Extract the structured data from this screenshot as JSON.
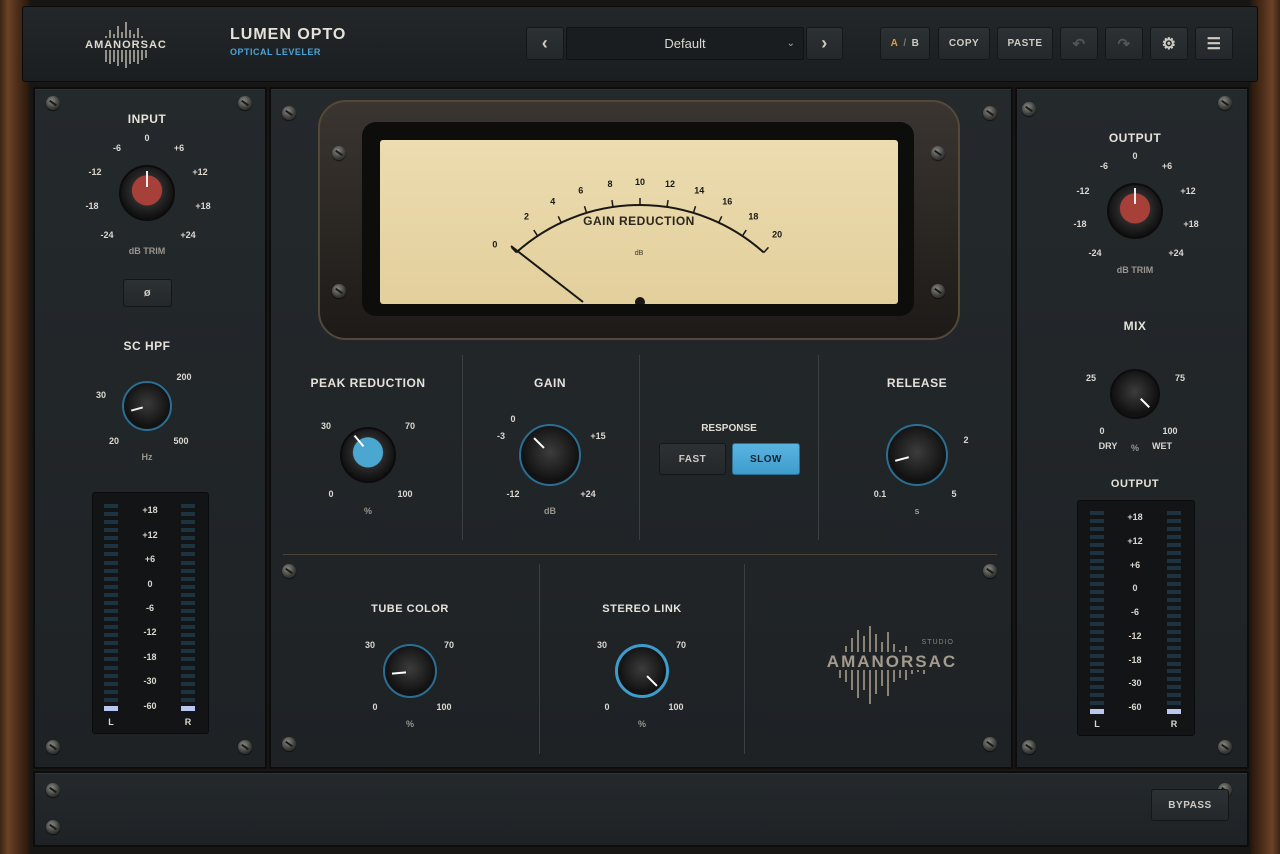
{
  "header": {
    "brand": "AMANORSAC",
    "plugin_name": "LUMEN OPTO",
    "plugin_subtitle": "OPTICAL LEVELER",
    "preset": "Default",
    "ab_a": "A",
    "ab_sep": "/",
    "ab_b": "B",
    "copy": "COPY",
    "paste": "PASTE"
  },
  "input": {
    "title": "INPUT",
    "unit": "dB TRIM",
    "ticks": [
      "-24",
      "-18",
      "-12",
      "-6",
      "0",
      "+6",
      "+12",
      "+18",
      "+24"
    ],
    "value_db": 0,
    "phase_label": "ø"
  },
  "sc_hpf": {
    "title": "SC HPF",
    "unit": "Hz",
    "ticks": [
      "20",
      "30",
      "200",
      "500"
    ]
  },
  "left_meter": {
    "scale": [
      "+18",
      "+12",
      "+6",
      "0",
      "-6",
      "-12",
      "-18",
      "-30",
      "-60"
    ],
    "l": "L",
    "r": "R"
  },
  "vu": {
    "title": "GAIN REDUCTION",
    "unit": "dB",
    "scale": [
      "0",
      "2",
      "4",
      "6",
      "8",
      "10",
      "12",
      "14",
      "16",
      "18",
      "20"
    ],
    "value_db": 0
  },
  "peak_reduction": {
    "title": "PEAK REDUCTION",
    "unit": "%",
    "ticks": [
      "0",
      "30",
      "70",
      "100"
    ]
  },
  "gain": {
    "title": "GAIN",
    "unit": "dB",
    "ticks": [
      "-12",
      "-3",
      "0",
      "+15",
      "+24"
    ]
  },
  "response": {
    "title": "RESPONSE",
    "fast": "FAST",
    "slow": "SLOW",
    "selected": "SLOW"
  },
  "release": {
    "title": "RELEASE",
    "unit": "s",
    "ticks": [
      "0.1",
      "2",
      "5"
    ]
  },
  "tube_color": {
    "title": "TUBE COLOR",
    "unit": "%",
    "ticks": [
      "0",
      "30",
      "70",
      "100"
    ]
  },
  "stereo_link": {
    "title": "STEREO LINK",
    "unit": "%",
    "ticks": [
      "0",
      "30",
      "70",
      "100"
    ]
  },
  "studio_logo": {
    "small": "STUDIO",
    "brand": "AMANORSAC"
  },
  "output": {
    "title": "OUTPUT",
    "unit": "dB TRIM",
    "ticks": [
      "-24",
      "-18",
      "-12",
      "-6",
      "0",
      "+6",
      "+12",
      "+18",
      "+24"
    ],
    "value_db": 0
  },
  "mix": {
    "title": "MIX",
    "unit": "%",
    "dry": "DRY",
    "wet": "WET",
    "ticks": [
      "0",
      "25",
      "75",
      "100"
    ]
  },
  "right_meter": {
    "title": "OUTPUT",
    "scale": [
      "+18",
      "+12",
      "+6",
      "0",
      "-6",
      "-12",
      "-18",
      "-30",
      "-60"
    ],
    "l": "L",
    "r": "R"
  },
  "footer": {
    "bypass": "BYPASS"
  },
  "colors": {
    "accent": "#4aa4d8",
    "red_knob": "#b33a36",
    "ab_active": "#e39a3a"
  }
}
